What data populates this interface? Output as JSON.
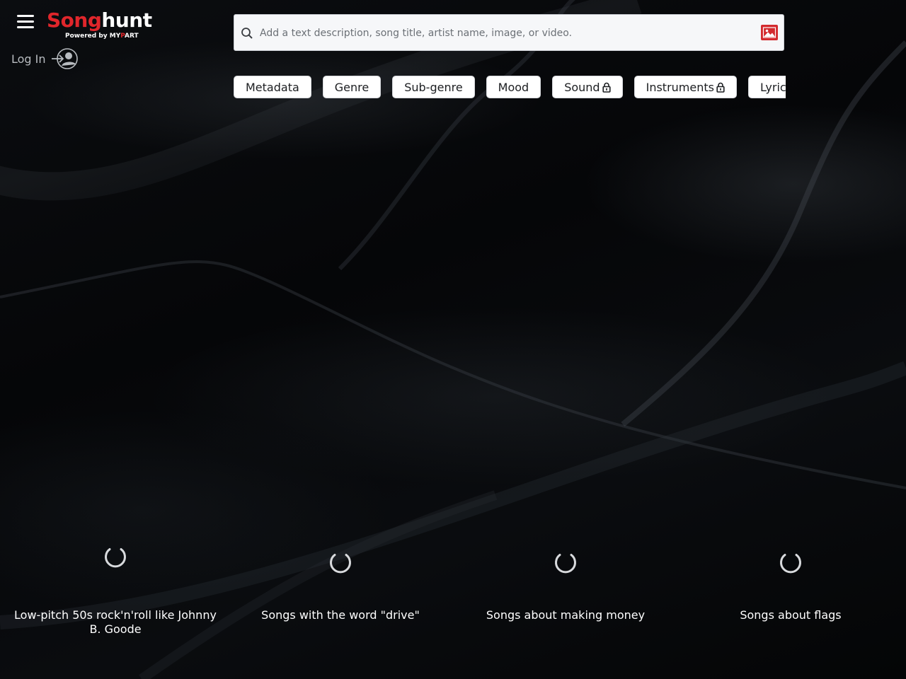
{
  "header": {
    "logo": {
      "song": "Song",
      "hunt": "hunt",
      "powered_by": "Powered by",
      "brand_a": "MY",
      "brand_p": "P",
      "brand_b": "ART"
    },
    "menu_icon": "hamburger-icon",
    "login": {
      "label": "Log In",
      "icon": "user-login-icon"
    }
  },
  "search": {
    "placeholder": "Add a text description, song title, artist name, image, or video.",
    "value": "",
    "icon": "search-icon",
    "upload_icon": "image-upload-icon"
  },
  "filters": [
    {
      "label": "Metadata",
      "locked": false
    },
    {
      "label": "Genre",
      "locked": false
    },
    {
      "label": "Sub-genre",
      "locked": false
    },
    {
      "label": "Mood",
      "locked": false
    },
    {
      "label": "Sound",
      "locked": true
    },
    {
      "label": "Instruments",
      "locked": true
    },
    {
      "label": "Lyrics",
      "locked": false
    }
  ],
  "suggestions": [
    {
      "text": "Low-pitch 50s rock'n'roll like Johnny B. Goode"
    },
    {
      "text": "Songs with the word \"drive\""
    },
    {
      "text": "Songs about making money"
    },
    {
      "text": "Songs about flags"
    }
  ],
  "colors": {
    "brand_red": "#e0262b",
    "background": "#050608",
    "button_bg": "#ffffff"
  }
}
